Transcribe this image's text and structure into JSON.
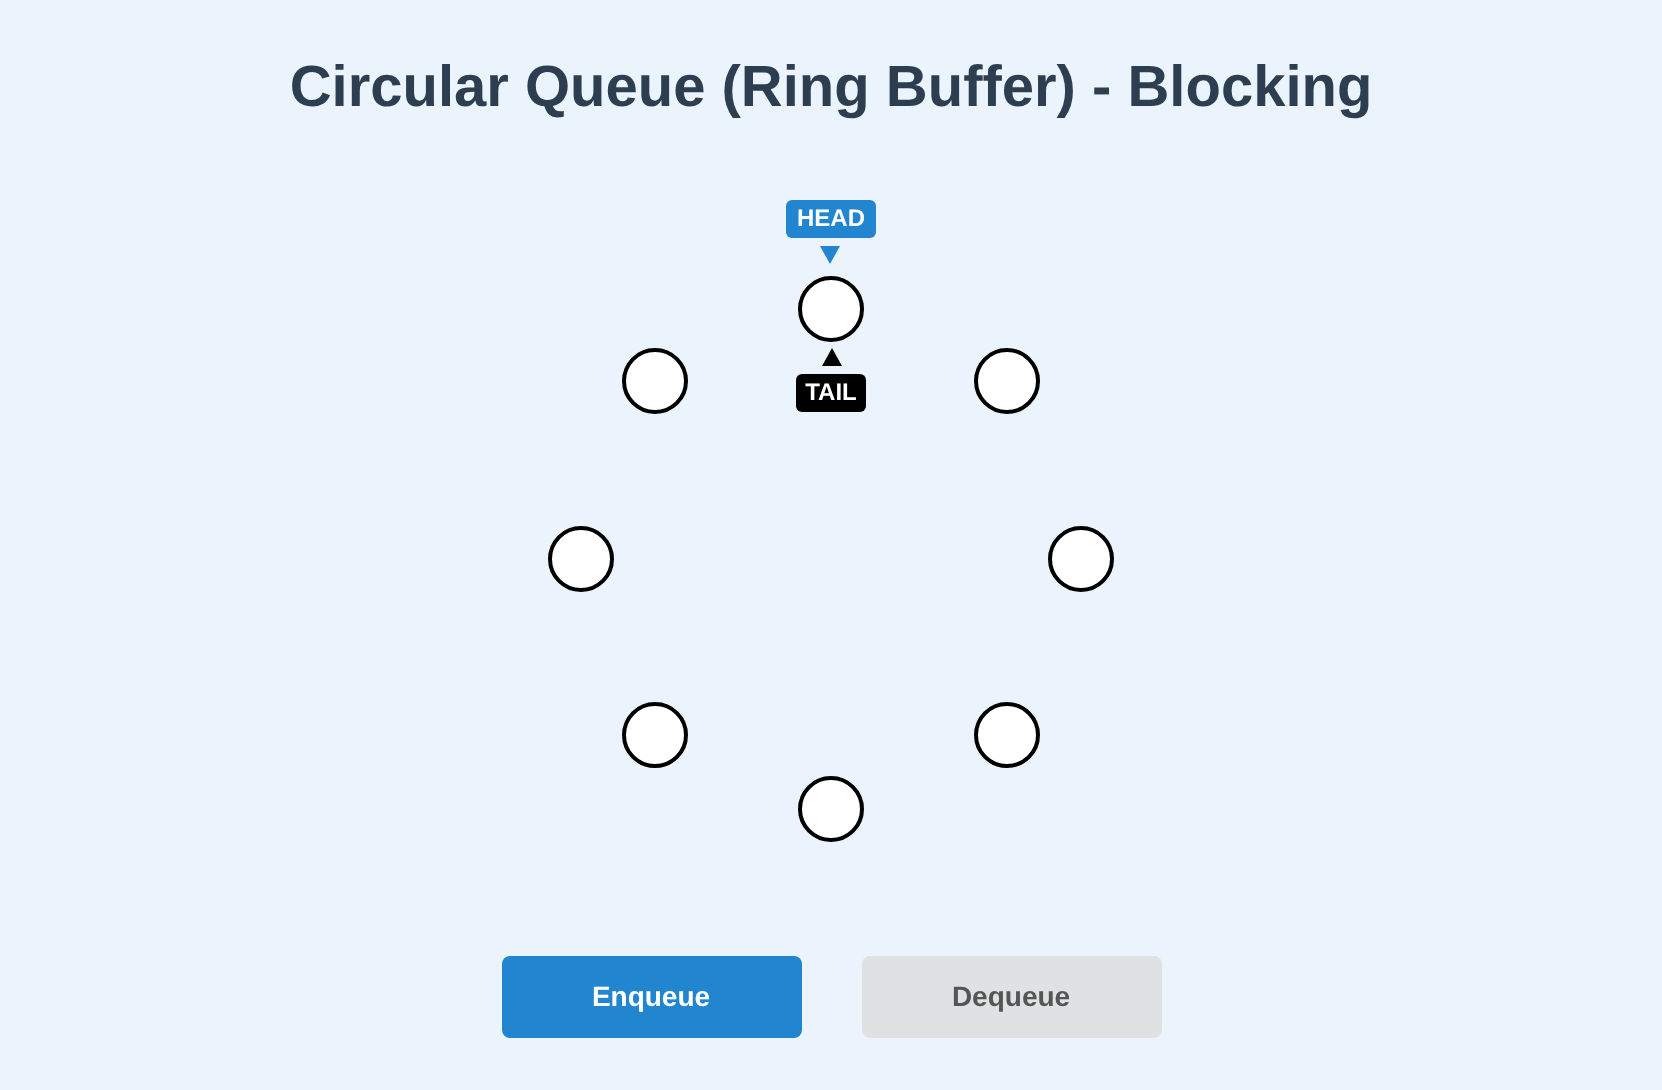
{
  "title": "Circular Queue (Ring Buffer) - Blocking",
  "ring": {
    "slots": [
      {
        "head": true,
        "tail": true
      },
      {
        "head": false,
        "tail": false
      },
      {
        "head": false,
        "tail": false
      },
      {
        "head": false,
        "tail": false
      },
      {
        "head": false,
        "tail": false
      },
      {
        "head": false,
        "tail": false
      },
      {
        "head": false,
        "tail": false
      },
      {
        "head": false,
        "tail": false
      }
    ],
    "head_label": "HEAD",
    "tail_label": "TAIL"
  },
  "buttons": [
    {
      "label": "Enqueue",
      "disabled": false
    },
    {
      "label": "Dequeue",
      "disabled": true
    }
  ]
}
